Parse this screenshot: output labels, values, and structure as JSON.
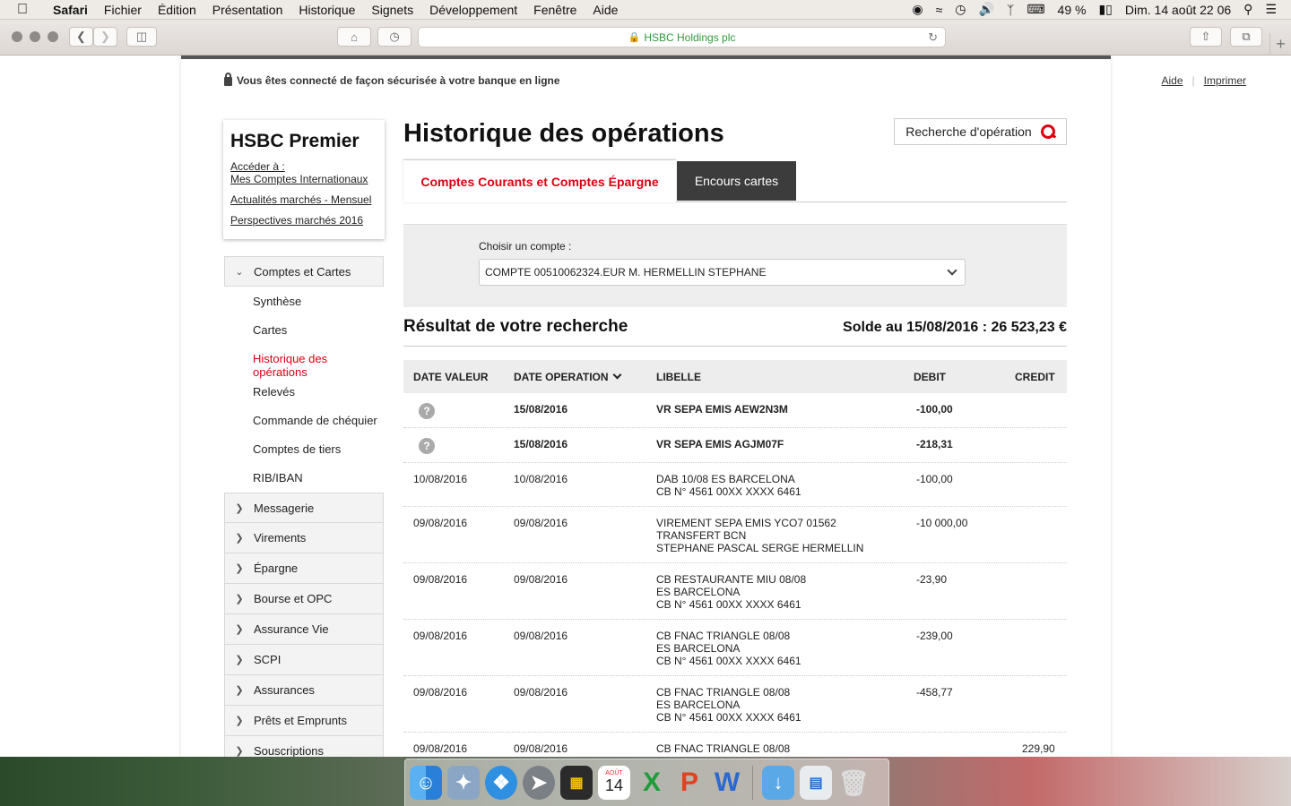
{
  "menubar": {
    "app": "Safari",
    "items": [
      "Fichier",
      "Édition",
      "Présentation",
      "Historique",
      "Signets",
      "Développement",
      "Fenêtre",
      "Aide"
    ],
    "battery": "49 %",
    "datetime": "Dim. 14 août  22 06"
  },
  "browser": {
    "url_title": "HSBC Holdings plc"
  },
  "header": {
    "secure_text": "Vous êtes connecté de façon sécurisée à votre banque en ligne",
    "help": "Aide",
    "print": "Imprimer"
  },
  "premier": {
    "title": "HSBC Premier",
    "links": [
      "Accéder à :",
      "Mes Comptes Internationaux",
      "Actualités marchés - Mensuel",
      "Perspectives marchés 2016"
    ]
  },
  "sidenav": {
    "open_section": "Comptes et Cartes",
    "subitems": [
      "Synthèse",
      "Cartes",
      "Historique des opérations",
      "Relevés",
      "Commande de chéquier",
      "Comptes de tiers",
      "RIB/IBAN"
    ],
    "sections": [
      "Messagerie",
      "Virements",
      "Épargne",
      "Bourse et OPC",
      "Assurance Vie",
      "SCPI",
      "Assurances",
      "Prêts et Emprunts",
      "Souscriptions"
    ]
  },
  "main": {
    "title": "Historique des opérations",
    "search_button": "Recherche d'opération",
    "tabs": [
      "Comptes Courants et Comptes Épargne",
      "Encours cartes"
    ],
    "account_label": "Choisir un compte :",
    "account_value": "COMPTE 00510062324.EUR M.  HERMELLIN STEPHANE",
    "result_title": "Résultat de votre recherche",
    "balance": "Solde au 15/08/2016 : 26 523,23 €"
  },
  "table": {
    "headers": [
      "DATE VALEUR",
      "DATE OPERATION",
      "LIBELLE",
      "DEBIT",
      "CREDIT"
    ],
    "rows": [
      {
        "pending": true,
        "date_valeur": "",
        "date_op": "15/08/2016",
        "libelle": [
          "VR SEPA EMIS AEW2N3M"
        ],
        "debit": "-100,00",
        "credit": ""
      },
      {
        "pending": true,
        "date_valeur": "",
        "date_op": "15/08/2016",
        "libelle": [
          "VR SEPA EMIS AGJM07F"
        ],
        "debit": "-218,31",
        "credit": ""
      },
      {
        "pending": false,
        "date_valeur": "10/08/2016",
        "date_op": "10/08/2016",
        "libelle": [
          "DAB 10/08 ES BARCELONA",
          "CB N° 4561 00XX XXXX 6461"
        ],
        "debit": "-100,00",
        "credit": ""
      },
      {
        "pending": false,
        "date_valeur": "09/08/2016",
        "date_op": "09/08/2016",
        "libelle": [
          "VIREMENT SEPA EMIS YCO7 01562",
          "TRANSFERT BCN",
          "STEPHANE PASCAL SERGE HERMELLIN"
        ],
        "debit": "-10 000,00",
        "credit": ""
      },
      {
        "pending": false,
        "date_valeur": "09/08/2016",
        "date_op": "09/08/2016",
        "libelle": [
          "CB RESTAURANTE MIU 08/08",
          "ES BARCELONA",
          "CB N° 4561 00XX XXXX 6461"
        ],
        "debit": "-23,90",
        "credit": ""
      },
      {
        "pending": false,
        "date_valeur": "09/08/2016",
        "date_op": "09/08/2016",
        "libelle": [
          "CB FNAC TRIANGLE 08/08",
          "ES BARCELONA",
          "CB N° 4561 00XX XXXX 6461"
        ],
        "debit": "-239,00",
        "credit": ""
      },
      {
        "pending": false,
        "date_valeur": "09/08/2016",
        "date_op": "09/08/2016",
        "libelle": [
          "CB FNAC TRIANGLE 08/08",
          "ES BARCELONA",
          "CB N° 4561 00XX XXXX 6461"
        ],
        "debit": "-458,77",
        "credit": ""
      },
      {
        "pending": false,
        "date_valeur": "09/08/2016",
        "date_op": "09/08/2016",
        "libelle": [
          "CB FNAC TRIANGLE 08/08"
        ],
        "debit": "",
        "credit": "229,90"
      }
    ]
  },
  "dock": {
    "calendar_month": "AOÛT",
    "calendar_day": "14"
  },
  "colors": {
    "brand_red": "#db0011",
    "dark_tab": "#3c3c3c",
    "panel_gray": "#eeeeee"
  }
}
